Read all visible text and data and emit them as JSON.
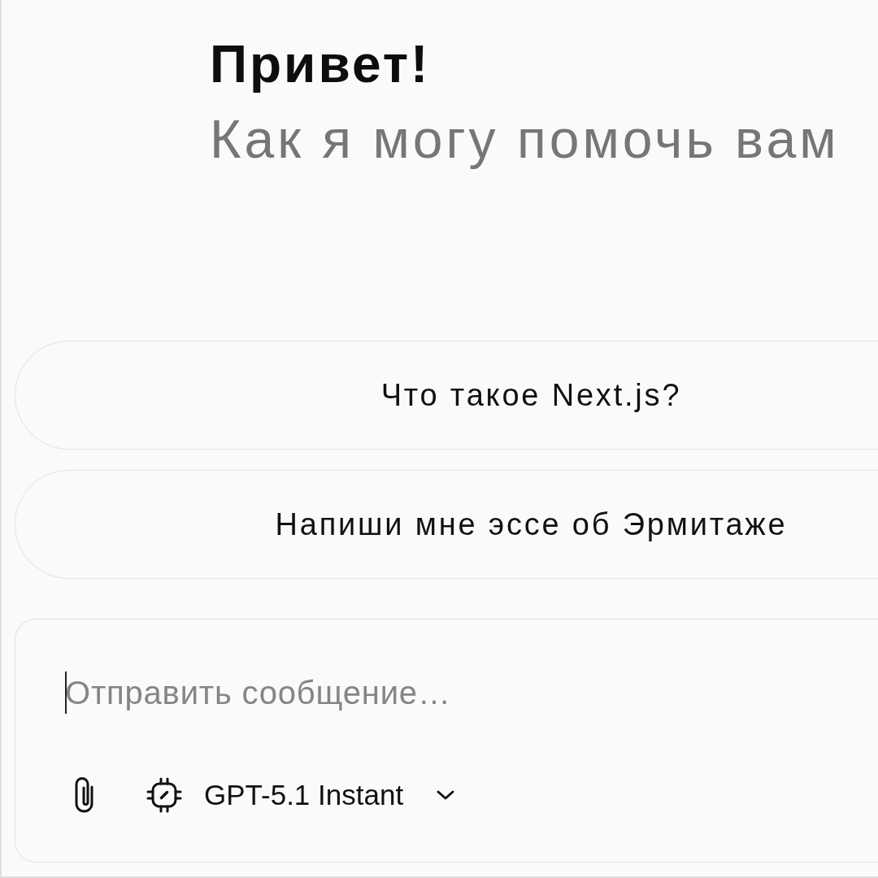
{
  "greeting": {
    "title": "Привет!",
    "subtitle": "Как я могу помочь вам"
  },
  "suggestions": [
    {
      "text": "Что такое Next.js?"
    },
    {
      "text": "Напиши мне эссе об Эрмитаже"
    }
  ],
  "composer": {
    "placeholder": "Отправить сообщение…",
    "focused": true,
    "model": {
      "label": "GPT-5.1 Instant"
    }
  }
}
